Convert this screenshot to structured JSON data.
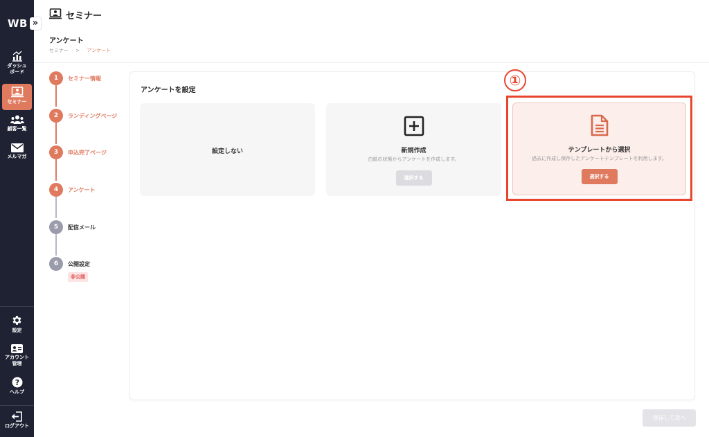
{
  "app": {
    "logo": "WB",
    "expand_icon": "»"
  },
  "sidebar": {
    "items": [
      {
        "label": "ダッシュ\nボード",
        "icon": "chart-icon"
      },
      {
        "label": "セミナー",
        "icon": "seminar-icon",
        "active": true
      },
      {
        "label": "顧客一覧",
        "icon": "users-icon"
      },
      {
        "label": "メルマガ",
        "icon": "mail-icon"
      }
    ],
    "bottom_items": [
      {
        "label": "設定",
        "icon": "gear-icon"
      },
      {
        "label": "アカウント\n管理",
        "icon": "account-card-icon"
      },
      {
        "label": "ヘルプ",
        "icon": "help-icon"
      },
      {
        "label": "ログアウト",
        "icon": "logout-icon"
      }
    ]
  },
  "header": {
    "title": "セミナー",
    "page_title": "アンケート",
    "breadcrumb": {
      "parent": "セミナー",
      "separator": ">",
      "current": "アンケート"
    }
  },
  "steps": [
    {
      "num": "1",
      "label": "セミナー情報",
      "done": true
    },
    {
      "num": "2",
      "label": "ランディングページ",
      "done": true
    },
    {
      "num": "3",
      "label": "申込完了ページ",
      "done": true
    },
    {
      "num": "4",
      "label": "アンケート",
      "done": true
    },
    {
      "num": "5",
      "label": "配信メール",
      "done": false
    },
    {
      "num": "6",
      "label": "公開設定",
      "done": false,
      "badge": "非公開"
    }
  ],
  "main": {
    "title": "アンケートを設定",
    "options": {
      "none": {
        "label": "設定しない"
      },
      "new": {
        "title": "新規作成",
        "desc": "白紙の状態からアンケートを作成します。",
        "button": "選択する"
      },
      "template": {
        "title": "テンプレートから選択",
        "desc": "過去に作成し保存したアンケートテンプレートを利用します。",
        "button": "選択する"
      }
    }
  },
  "annotation": {
    "number": "①"
  },
  "footer": {
    "save_button": "保存して次へ"
  },
  "colors": {
    "accent": "#e07a5f",
    "sidebar_bg": "#1f2233",
    "annotation": "#e9452e"
  }
}
